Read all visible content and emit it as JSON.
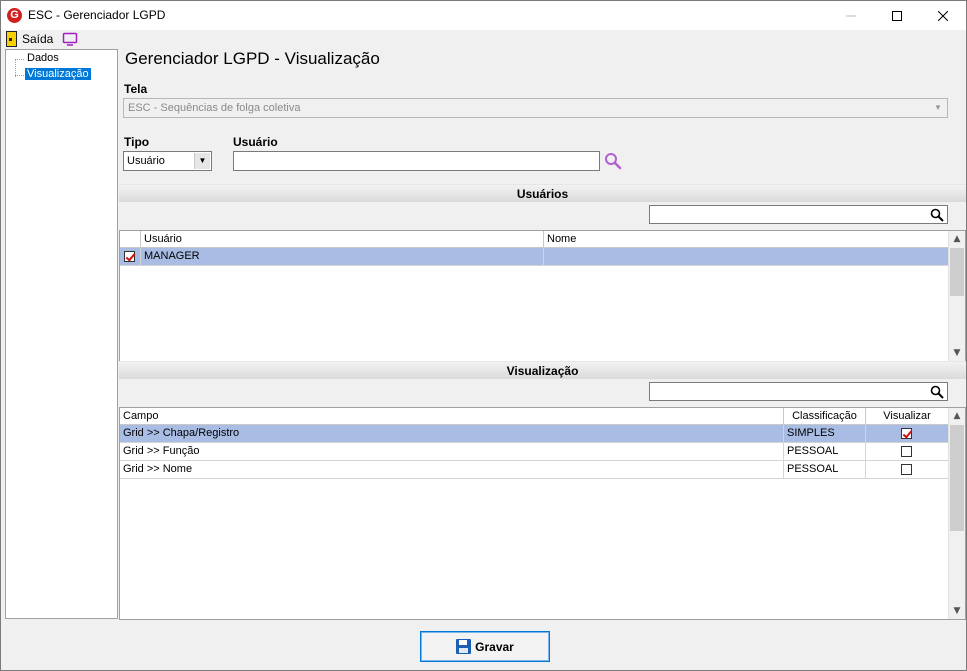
{
  "window": {
    "title": "ESC - Gerenciador LGPD",
    "logo_letter": "G"
  },
  "menu": {
    "exit_label": "Saída",
    "exit_icon": "exit-door-icon",
    "monitor_icon": "monitor-icon"
  },
  "tree": {
    "items": [
      {
        "label": "Dados",
        "selected": false
      },
      {
        "label": "Visualização",
        "selected": true
      }
    ]
  },
  "main": {
    "title": "Gerenciador LGPD - Visualização",
    "screen_label": "Tela",
    "screen_value": "ESC - Sequências de folga coletiva",
    "type_label": "Tipo",
    "type_value": "Usuário",
    "user_label": "Usuário",
    "user_value": ""
  },
  "users_section": {
    "title": "Usuários",
    "filter_value": "",
    "columns": [
      "Usuário",
      "Nome"
    ],
    "rows": [
      {
        "checked": true,
        "usuario": "MANAGER",
        "nome": "",
        "selected": true
      }
    ]
  },
  "view_section": {
    "title": "Visualização",
    "filter_value": "",
    "columns": [
      "Campo",
      "Classificação",
      "Visualizar"
    ],
    "rows": [
      {
        "campo": "Grid >> Chapa/Registro",
        "classificacao": "SIMPLES",
        "visualizar": true,
        "selected": true
      },
      {
        "campo": "Grid >> Função",
        "classificacao": "PESSOAL",
        "visualizar": false,
        "selected": false
      },
      {
        "campo": "Grid >> Nome",
        "classificacao": "PESSOAL",
        "visualizar": false,
        "selected": false
      }
    ]
  },
  "footer": {
    "save_label": "Gravar"
  },
  "colors": {
    "selection": "#a9bde4",
    "tree_selection": "#0078d7",
    "accent_search": "#a040c0"
  }
}
